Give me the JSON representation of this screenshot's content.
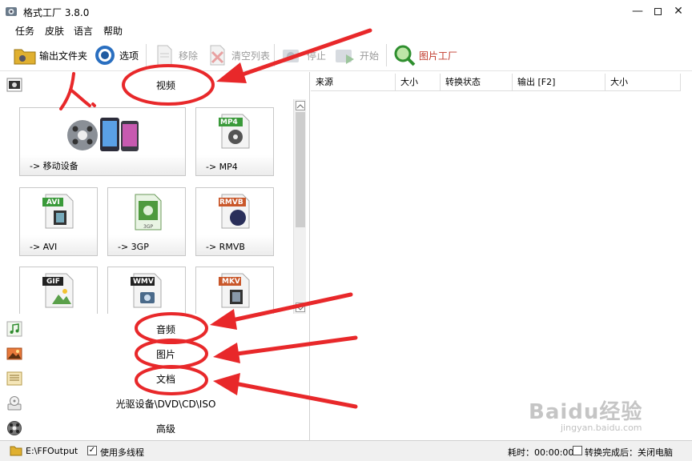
{
  "window": {
    "title": "格式工厂 3.8.0",
    "minimize": "—",
    "close": "✕"
  },
  "menu": [
    "任务",
    "皮肤",
    "语言",
    "帮助"
  ],
  "toolbar": {
    "output_folder": "输出文件夹",
    "options": "选项",
    "remove": "移除",
    "clear_list": "清空列表",
    "stop": "停止",
    "start": "开始",
    "picture_factory": "图片工厂"
  },
  "categories": {
    "video": "视频",
    "audio": "音频",
    "picture": "图片",
    "document": "文档",
    "rom": "光驱设备\\DVD\\CD\\ISO",
    "advanced": "高级"
  },
  "video_tiles": [
    {
      "label": "-> 移动设备"
    },
    {
      "label": "-> MP4",
      "badge": "MP4"
    },
    {
      "label": "-> AVI",
      "badge": "AVI"
    },
    {
      "label": "-> 3GP",
      "badge": "3GP"
    },
    {
      "label": "-> RMVB",
      "badge": "RMVB"
    },
    {
      "label": "",
      "badge": "GIF"
    },
    {
      "label": "",
      "badge": "WMV"
    },
    {
      "label": "",
      "badge": "MKV"
    }
  ],
  "columns": [
    "来源",
    "大小",
    "转换状态",
    "输出 [F2]",
    "大小"
  ],
  "statusbar": {
    "output_path": "E:\\FFOutput",
    "multithread": "使用多线程",
    "elapsed": "耗时：00:00:00",
    "after_done": "转换完成后：关闭电脑"
  },
  "annotation": {
    "step_number": "1."
  },
  "watermark": {
    "brand": "Baidu经验",
    "url": "jingyan.baidu.com"
  },
  "colors": {
    "arrow_red": "#e8282a",
    "status_bg": "#f0f0f0",
    "badge_green": "#3a9a3a"
  }
}
